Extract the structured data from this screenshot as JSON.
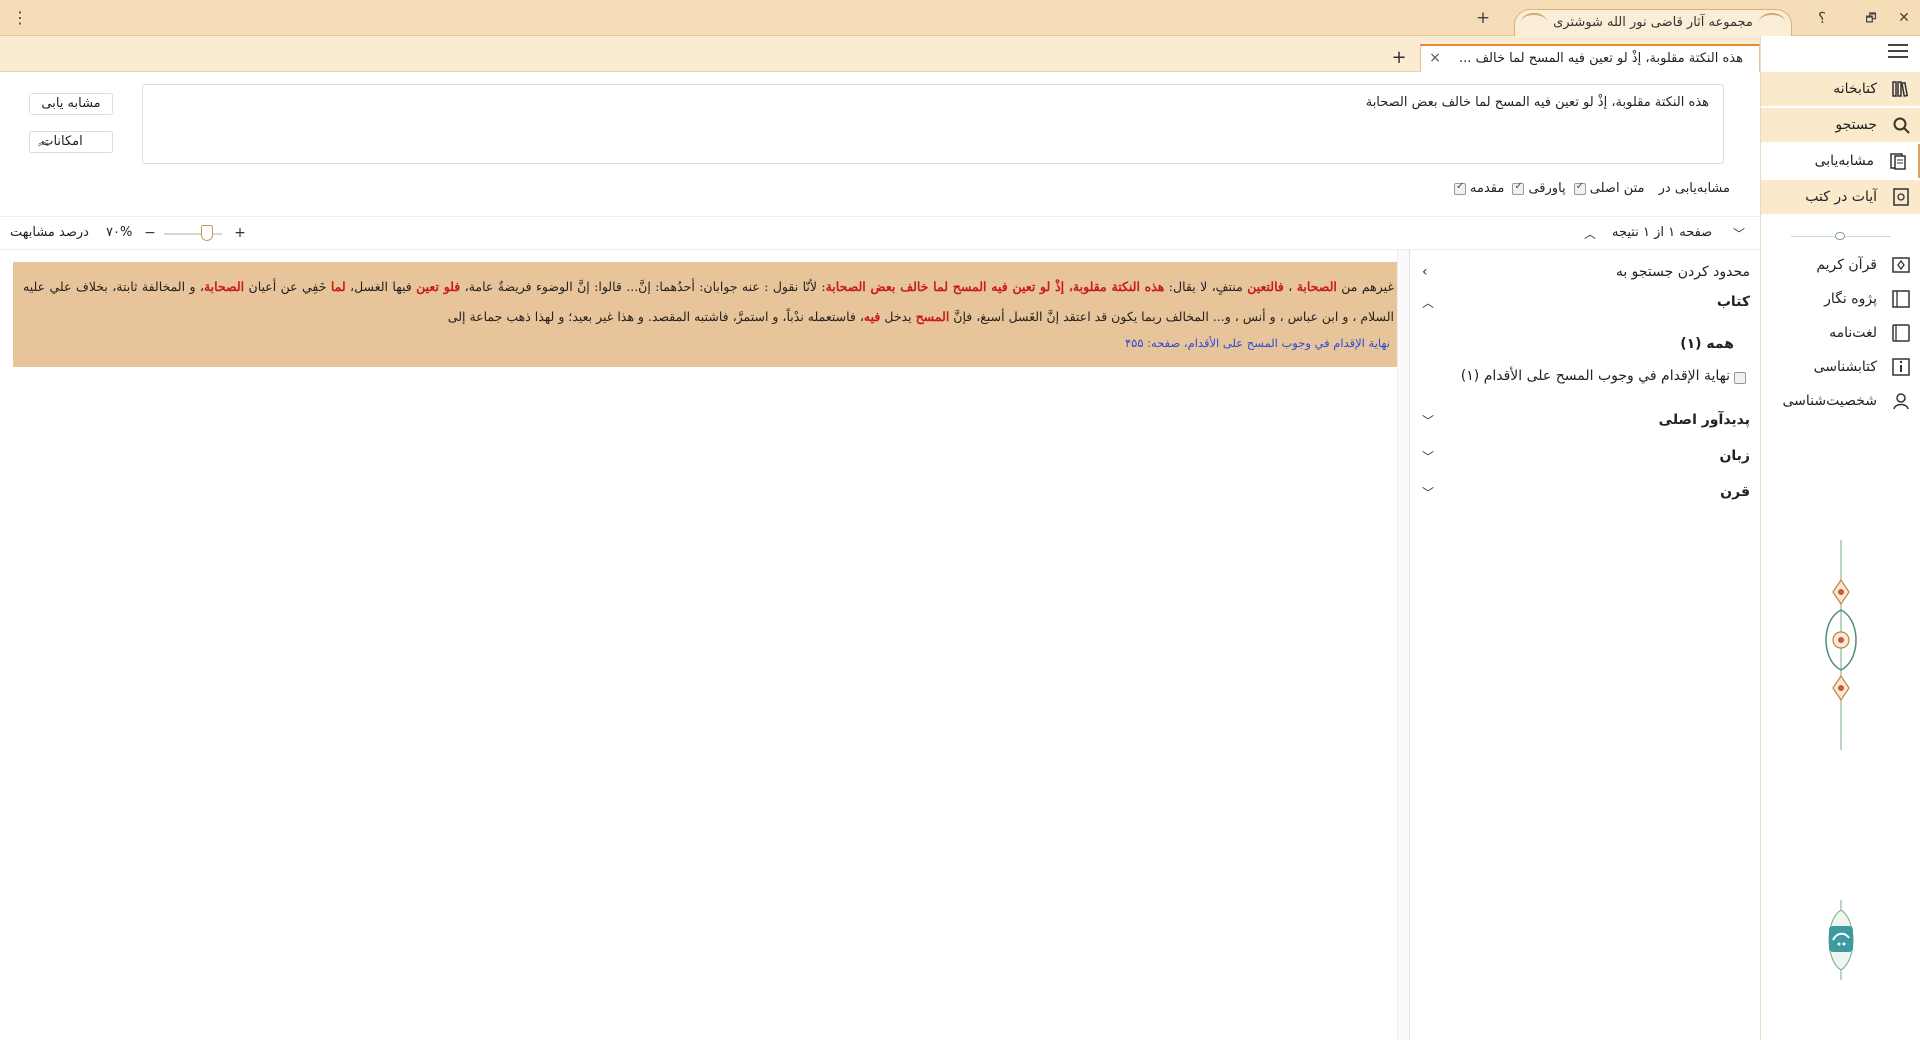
{
  "window": {
    "title": "مجموعه آثار قاضی نور الله شوشتری",
    "add_window_label": "+",
    "help_label": "؟",
    "restore_label": "🗗",
    "close_label": "✕",
    "kebab_label": "⋮"
  },
  "tabs": [
    {
      "label": "هذه النکتة مقلوبة، إذْ لو تعین فیه المسح لما خالف ...",
      "close_label": "×"
    }
  ],
  "add_tab_label": "+",
  "sidebar": {
    "items": [
      {
        "label": "کتابخانه",
        "icon": "library-icon"
      },
      {
        "label": "جستجو",
        "icon": "search-icon"
      },
      {
        "label": "مشابه‌یابی",
        "icon": "similar-find-icon"
      },
      {
        "label": "آیات در کتب",
        "icon": "verses-in-books-icon"
      },
      {
        "label": "قرآن کریم",
        "icon": "quran-icon"
      },
      {
        "label": "پژوه نگار",
        "icon": "notebook-icon"
      },
      {
        "label": "لغت‌نامه",
        "icon": "dictionary-icon"
      },
      {
        "label": "کتابشناسی",
        "icon": "bibliography-icon"
      },
      {
        "label": "شخصیت‌شناسی",
        "icon": "biography-icon"
      }
    ]
  },
  "search": {
    "query": "هذه النکتة مقلوبة، إذْ لو تعین فیه المسح لما خالف بعض الصحابة",
    "find_similar_label": "مشابه یابی",
    "options_label": "امکانات",
    "options_toggle_icon": "double-chevron-up-icon",
    "scope_label": "مشابه‌یابی در",
    "scope_options": [
      {
        "label": "متن اصلی",
        "checked": true
      },
      {
        "label": "پاورقی",
        "checked": true
      },
      {
        "label": "مقدمه",
        "checked": true
      }
    ]
  },
  "toolbar": {
    "similarity_label": "درصد مشابهت",
    "similarity_value": "۷۰%",
    "similarity_level_percent": 70,
    "minus_label": "−",
    "plus_label": "+",
    "page_info": "صفحه ۱ از ۱ نتیجه"
  },
  "result": {
    "segments": [
      {
        "t": "غیرهم من ",
        "h": false
      },
      {
        "t": "الصحابة",
        "h": true
      },
      {
        "t": " ، ",
        "h": false
      },
      {
        "t": "فالتعین",
        "h": true
      },
      {
        "t": " منتفٍ، لا یقال: ",
        "h": false
      },
      {
        "t": "هذه النکتة مقلوبة، إذْ لو تعین فیه المسح لما خالف بعض الصحابة",
        "h": true
      },
      {
        "t": ": لأنّا نقول : عنه جوابان: أحدُهما: إنَّ... قالوا: إنَّ الوضوء فریضةٌ عامة، ",
        "h": false
      },
      {
        "t": "فلو تعین",
        "h": true
      },
      {
        "t": " فیها الغسل، ",
        "h": false
      },
      {
        "t": "لما",
        "h": true
      },
      {
        "t": " خَفِي عن أعیان ",
        "h": false
      },
      {
        "t": "الصحابة",
        "h": true
      },
      {
        "t": "، و المخالفة ثابتة، بخلاف علي علیه السلام ، و ابن عباس ، و أنس ، و... المخالف ربما یکون قد اعتقد إنَّ الغَسل أسبغ، فإنَّ ",
        "h": false
      },
      {
        "t": "المسح",
        "h": true
      },
      {
        "t": " یدخل ",
        "h": false
      },
      {
        "t": "فیه",
        "h": true
      },
      {
        "t": "، فاستعمله ندْباً، و استمرَّ، فاشتبه المقصد. و هذا غیر بعید؛ و لهذا ذهب جماعة إلی",
        "h": false
      }
    ],
    "source": "نهایة الإقدام في وجوب المسح علی الأقدام، صفحه: ۴۵۵"
  },
  "filter": {
    "title": "محدود کردن جستجو به",
    "groups": [
      {
        "label": "کتاب",
        "expanded": true
      },
      {
        "label": "پدیدآور اصلی",
        "expanded": false
      },
      {
        "label": "زبان",
        "expanded": false
      },
      {
        "label": "قرن",
        "expanded": false
      }
    ],
    "book_all_label": "همه (۱)",
    "book_items": [
      {
        "label": "نهایة الإقدام في وجوب المسح علی الأقدام (۱)",
        "checked": false
      }
    ]
  },
  "colors": {
    "accent": "#d9a35a",
    "titlebar_bg": "#f5ddb8",
    "result_bg": "#e8c49a",
    "highlight_text": "#c81b1b",
    "source_link": "#2a4bd7"
  }
}
